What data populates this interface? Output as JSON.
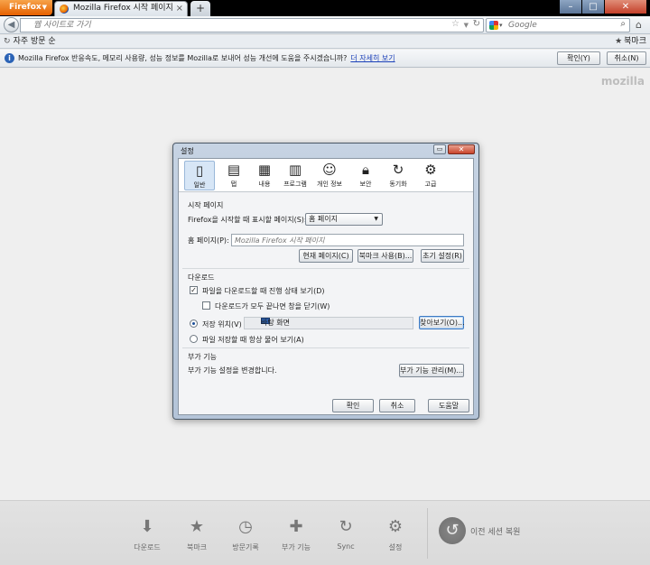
{
  "browser": {
    "menu_button": "Firefox",
    "tab_title": "Mozilla Firefox 시작 페이지",
    "new_tab": "+",
    "url_placeholder": "웹 사이트로 가기",
    "search_placeholder": "Google",
    "bookmarks_toolbar_item": "자주 방문 순",
    "bookmarks_menu": "북마크",
    "brand_logo": "mozilla"
  },
  "notification": {
    "message": "Mozilla Firefox 반응속도, 메모리 사용량, 성능 정보를 Mozilla로 보내어 성능 개선에 도움을 주시겠습니까?",
    "link": "더 자세히 보기",
    "ok": "확인(Y)",
    "cancel": "취소(N)"
  },
  "dialog": {
    "title": "설정",
    "panes": [
      {
        "label": "일반",
        "icon": "general-icon"
      },
      {
        "label": "탭",
        "icon": "tabs-icon"
      },
      {
        "label": "내용",
        "icon": "content-icon"
      },
      {
        "label": "프로그램",
        "icon": "applications-icon"
      },
      {
        "label": "개인 정보",
        "icon": "privacy-icon"
      },
      {
        "label": "보안",
        "icon": "security-icon"
      },
      {
        "label": "동기화",
        "icon": "sync-icon"
      },
      {
        "label": "고급",
        "icon": "advanced-icon"
      }
    ],
    "startup": {
      "group": "시작 페이지",
      "when_label": "Firefox을 시작할 때 표시할 페이지(S):",
      "when_value": "홈 페이지",
      "home_label": "홈 페이지(P):",
      "home_placeholder": "Mozilla Firefox 시작 페이지",
      "use_current": "현재 페이지(C)",
      "use_bookmark": "북마크 사용(B)...",
      "restore_default": "초기 설정(R)"
    },
    "downloads": {
      "group": "다운로드",
      "show_window": "파일을 다운로드할 때 진행 상태 보기(D)",
      "close_when_done": "다운로드가 모두 끝나면 창을 닫기(W)",
      "save_to": "저장 위치(V)",
      "folder": "바탕 화면",
      "browse": "찾아보기(O)...",
      "always_ask": "파일 저장할 때 항상 물어 보기(A)"
    },
    "addons": {
      "group": "부가 기능",
      "description": "부가 기능 설정을 변경합니다.",
      "manage": "부가 기능 관리(M)..."
    },
    "buttons": {
      "ok": "확인",
      "cancel": "취소",
      "help": "도움말"
    }
  },
  "launcher": {
    "items": [
      {
        "label": "다운로드",
        "icon": "download-icon"
      },
      {
        "label": "북마크",
        "icon": "bookmark-star-icon"
      },
      {
        "label": "방문기록",
        "icon": "history-clock-icon"
      },
      {
        "label": "부가 기능",
        "icon": "addons-puzzle-icon"
      },
      {
        "label": "Sync",
        "icon": "sync-icon"
      },
      {
        "label": "설정",
        "icon": "settings-gear-icon"
      }
    ],
    "restore_session": "이전 세션 복원"
  }
}
